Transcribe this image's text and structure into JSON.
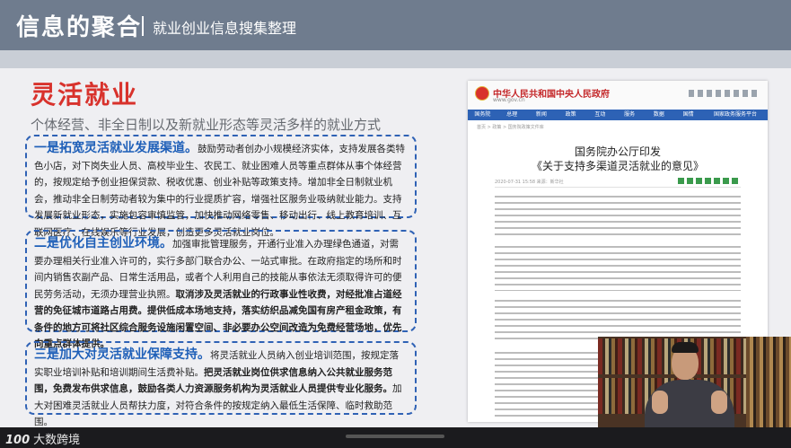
{
  "header": {
    "title": "信息的聚合",
    "subtitle": "就业创业信息搜集整理"
  },
  "slide": {
    "title": "灵活就业",
    "subtitle": "个体经营、非全日制以及新就业形态等灵活多样的就业方式",
    "boxes": [
      {
        "lead": "一是拓宽灵活就业发展渠道。",
        "body": "鼓励劳动者创办小规模经济实体，支持发展各类特色小店，对下岗失业人员、高校毕业生、农民工、就业困难人员等重点群体从事个体经营的，按规定给予创业担保贷款、税收优惠、创业补贴等政策支持。增加非全日制就业机会，推动非全日制劳动者较为集中的行业提质扩容，增强社区服务业吸纳就业能力。支持发展新就业形态，实施包容审慎监管，加快推动网络零售、移动出行、线上教育培训、互联网医疗、在线娱乐等行业发展，创造更多灵活就业岗位。"
      },
      {
        "lead": "二是优化自主创业环境。",
        "body_a": "加强审批管理服务，开通行业准入办理绿色通道，对需要办理相关行业准入许可的，实行多部门联合办公、一站式审批。在政府指定的场所和时间内销售农副产品、日常生活用品，或者个人利用自己的技能从事依法无须取得许可的便民劳务活动，无须办理营业执照。",
        "body_b": "取消涉及灵活就业的行政事业性收费，对经批准占道经营的免征城市道路占用费。提供低成本场地支持，落实纺织品减免国有房产租金政策，有条件的地方可将社区综合服务设施闲置空间、非必要办公空间改造为免费经营场地，优先向重点群体提供。"
      },
      {
        "lead": "三是加大对灵活就业保障支持。",
        "body_a": "将灵活就业人员纳入创业培训范围，按规定落实职业培训补贴和培训期间生活费补贴。",
        "body_b": "把灵活就业岗位供求信息纳入公共就业服务范围，免费发布供求信息，鼓励各类人力资源服务机构为灵活就业人员提供专业化服务。",
        "body_c": "加大对困难灵活就业人员帮扶力度，对符合条件的按规定纳入最低生活保障、临时救助范围。"
      }
    ]
  },
  "document": {
    "site_name": "中华人民共和国中央人民政府",
    "site_url": "www.gov.cn",
    "nav": [
      "国务院",
      "总理",
      "新闻",
      "政策",
      "互动",
      "服务",
      "数据",
      "国情",
      "国家政务服务平台"
    ],
    "crumb": "首页 > 政策 > 国务院政策文件库",
    "title_line1": "国务院办公厅印发",
    "title_line2": "《关于支持多渠道灵活就业的意见》",
    "meta": "2020-07-31 15:58   来源：新华社"
  },
  "footer": {
    "logo_text": "大数跨境",
    "logo_mark": "100"
  },
  "colors": {
    "accent_red": "#d8322c",
    "accent_blue": "#1e5fb8",
    "header_gray": "#6f7c8e"
  }
}
